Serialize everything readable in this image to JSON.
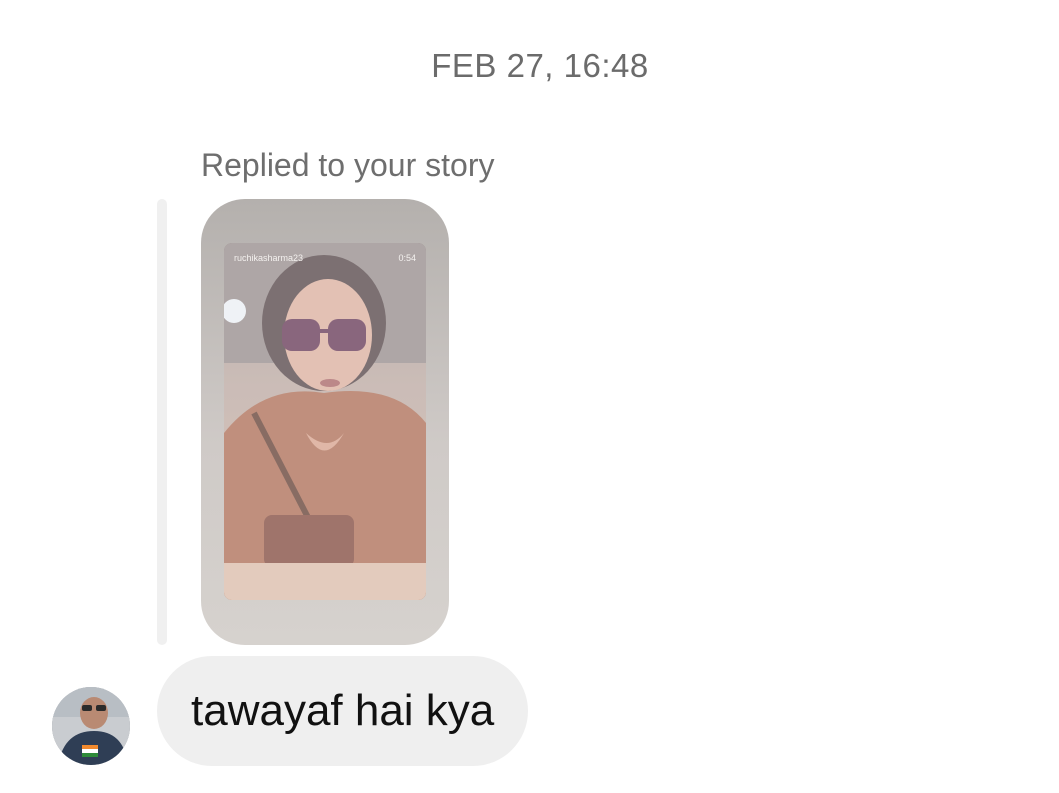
{
  "thread": {
    "timestamp": "FEB 27, 16:48"
  },
  "story_reply": {
    "label": "Replied to your story",
    "story_username": "ruchikasharma23",
    "story_duration": "0:54"
  },
  "message": {
    "text": "tawayaf hai kya"
  },
  "colors": {
    "bubble": "#efefef",
    "muted_text": "#6e6e6e",
    "message_text": "#111111"
  }
}
